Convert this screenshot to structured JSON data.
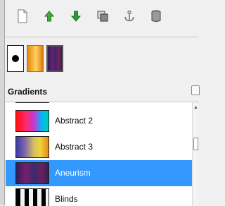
{
  "toolbar": {
    "buttons": [
      {
        "icon": "new-document-icon"
      },
      {
        "icon": "raise-arrow-icon"
      },
      {
        "icon": "lower-arrow-icon"
      },
      {
        "icon": "duplicate-icon"
      },
      {
        "icon": "anchor-icon"
      },
      {
        "icon": "trash-icon"
      }
    ]
  },
  "brushes": {
    "swatches": [
      {
        "name": "foreground-background-swatch"
      },
      {
        "name": "pattern-swatch"
      },
      {
        "name": "gradient-swatch"
      }
    ]
  },
  "gradients": {
    "title": "Gradients",
    "items": [
      {
        "label": "Abstract 2",
        "selected": false
      },
      {
        "label": "Abstract 3",
        "selected": false
      },
      {
        "label": "Aneurism",
        "selected": true
      },
      {
        "label": "Blinds",
        "selected": false
      }
    ]
  },
  "colors": {
    "selection": "#3399ff",
    "raise_arrow": "#3aaa3a",
    "lower_arrow": "#2f9a2f"
  }
}
